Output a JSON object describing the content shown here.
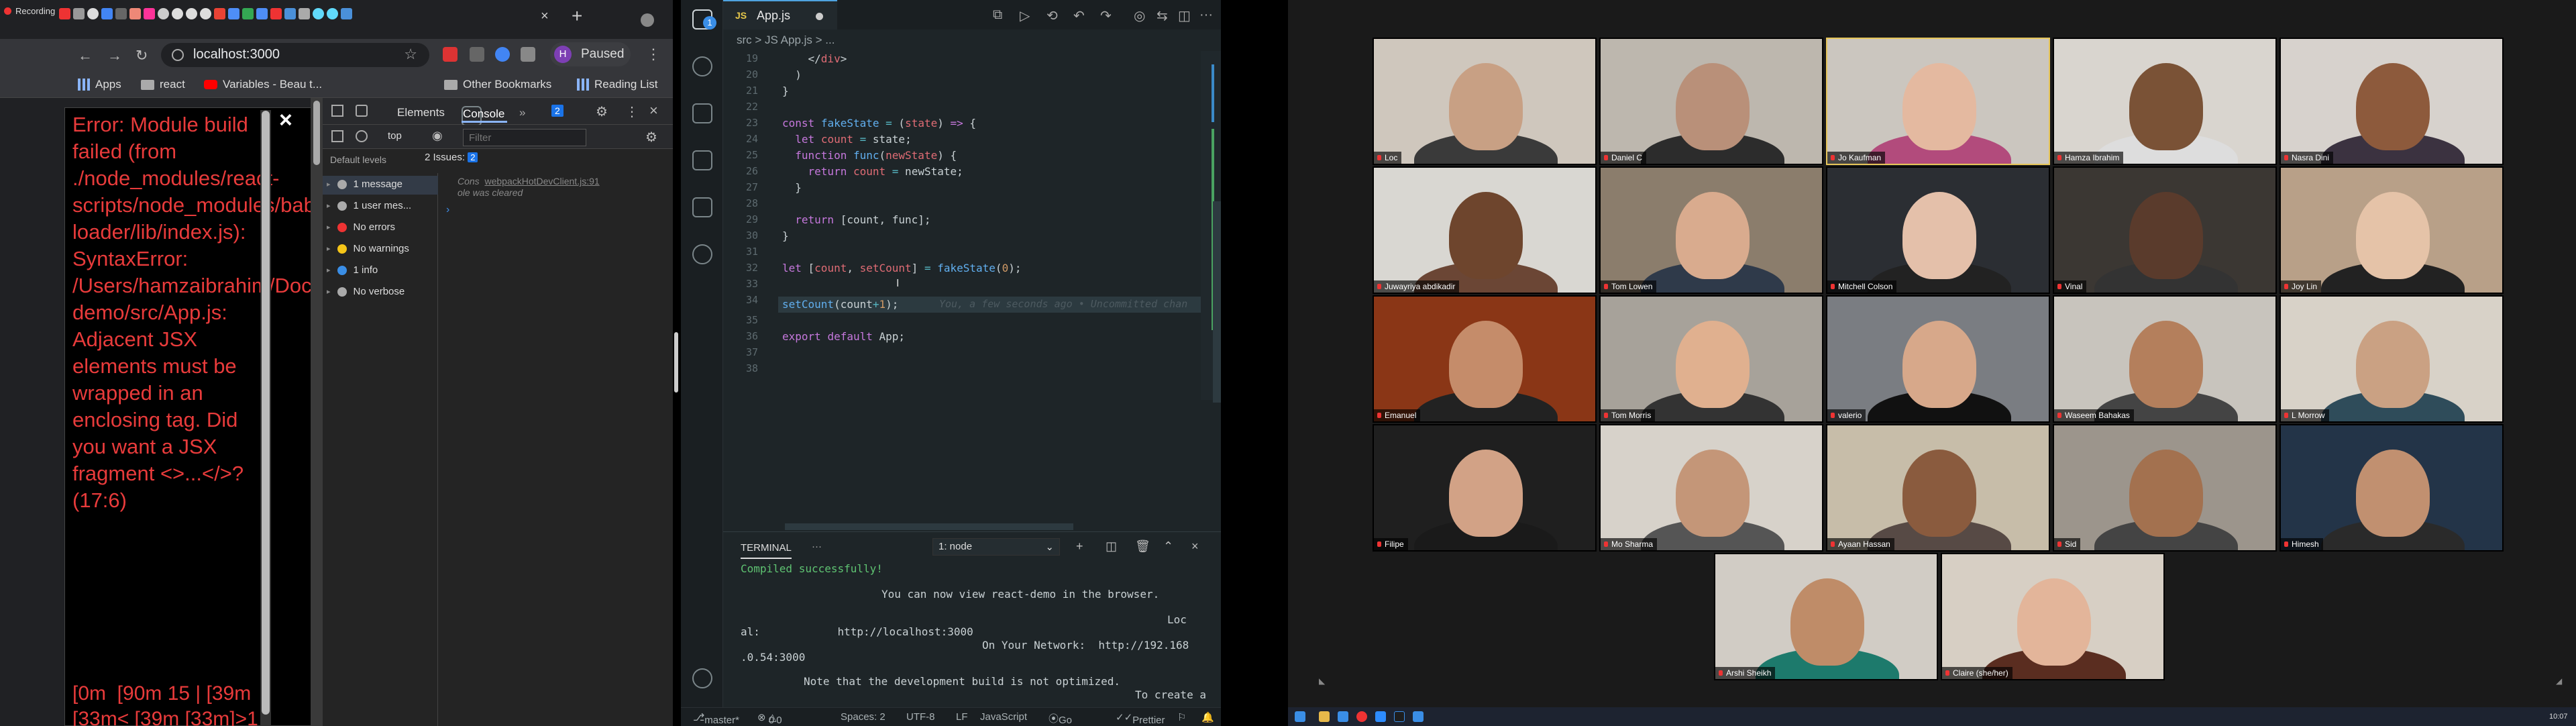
{
  "recording": {
    "label": "Recording"
  },
  "browser": {
    "tabs": [
      {
        "icon": "youtube",
        "color": "#e33"
      },
      {
        "icon": "gear",
        "color": "#999"
      },
      {
        "icon": "github",
        "color": "#ddd"
      },
      {
        "icon": "google",
        "color": "#4285f4"
      },
      {
        "icon": "codepen",
        "color": "#666"
      },
      {
        "icon": "box",
        "color": "#e87"
      },
      {
        "icon": "box",
        "color": "#f39"
      },
      {
        "icon": "circle",
        "color": "#ccc"
      },
      {
        "icon": "github",
        "color": "#ddd"
      },
      {
        "icon": "github",
        "color": "#ddd"
      },
      {
        "icon": "github",
        "color": "#ddd"
      },
      {
        "icon": "google",
        "color": "#ea4335"
      },
      {
        "icon": "doc",
        "color": "#4e8ef7"
      },
      {
        "icon": "doc",
        "color": "#34a853"
      },
      {
        "icon": "box",
        "color": "#4e8ef7"
      },
      {
        "icon": "box",
        "color": "#e33"
      },
      {
        "icon": "box",
        "color": "#4a90d9"
      },
      {
        "icon": "box",
        "color": "#aaa"
      },
      {
        "icon": "react",
        "color": "#61dafb"
      },
      {
        "icon": "react",
        "color": "#61dafb"
      },
      {
        "icon": "doc",
        "color": "#4a90d9"
      }
    ],
    "url": "localhost:3000",
    "profile_initial": "H",
    "profile_state": "Paused",
    "bookmarks": {
      "apps": "Apps",
      "react": "react",
      "variables": "Variables - Beau t...",
      "other": "Other Bookmarks",
      "reading": "Reading List"
    }
  },
  "error_overlay": {
    "message": "Error: Module build failed (from ./node_modules/react-scripts/node_modules/babel-loader/lib/index.js): SyntaxError: /Users/hamzaibrahim/Documents/react-demo/src/App.js: Adjacent JSX elements must be wrapped in an enclosing tag. Did you want a JSX fragment <>...</>? (17:6)",
    "code_fragment": "[0m  [90m 15 | [39m\n[33m< [39m [33m]>1"
  },
  "devtools": {
    "tabs": [
      "Elements",
      "Console"
    ],
    "more": "»",
    "badge": "2",
    "context": "top",
    "filter_placeholder": "Filter",
    "default_levels": "Default levels",
    "issues_label": "2 Issues:",
    "issues_count": "2",
    "sidebar": [
      {
        "label": "1 message",
        "icon": "list",
        "color": "#aaa"
      },
      {
        "label": "1 user mes...",
        "icon": "user",
        "color": "#aaa"
      },
      {
        "label": "No errors",
        "icon": "error",
        "color": "#e33"
      },
      {
        "label": "No warnings",
        "icon": "warning",
        "color": "#f5c518"
      },
      {
        "label": "1 info",
        "icon": "info",
        "color": "#3a8ee6"
      },
      {
        "label": "No verbose",
        "icon": "bug",
        "color": "#aaa"
      }
    ],
    "console_source": "webpackHotDevClient.js:91",
    "console_prefix": "Cons",
    "console_message": "ole was cleared",
    "prompt": "›"
  },
  "vscode": {
    "tab_name": "App.js",
    "tab_lang": "JS",
    "breadcrumb": "src  >  JS App.js  >  ...",
    "explorer_badge": "1",
    "line_numbers": [
      "19",
      "20",
      "21",
      "22",
      "23",
      "24",
      "25",
      "26",
      "27",
      "28",
      "29",
      "30",
      "31",
      "32",
      "33",
      "34",
      "35",
      "36",
      "37",
      "38"
    ],
    "blame": "You, a few seconds ago • Uncommitted chan",
    "terminal": {
      "tab": "TERMINAL",
      "more": "···",
      "selector": "1: node",
      "lines": [
        "Compiled successfully!",
        "You can now view react-demo in the browser.",
        "Loc",
        "al:            http://localhost:3000",
        "On Your Network:  http://192.168",
        ".0.54:3000",
        "Note that the development build is not optimized.",
        "To create a"
      ]
    },
    "status": {
      "branch": "master*",
      "problems": "0",
      "warnings": "0",
      "spaces": "Spaces: 2",
      "encoding": "UTF-8",
      "eol": "LF",
      "language": "JavaScript",
      "golive": "Go Live",
      "prettier": "Prettier"
    }
  },
  "zoom": {
    "participants": [
      {
        "name": "Loc",
        "skin": "#c8a084",
        "shirt": "#3a3a3a",
        "bg": "#cfc7bd"
      },
      {
        "name": "Daniel C",
        "skin": "#b99079",
        "shirt": "#2c2c2c",
        "bg": "#bdb7ae"
      },
      {
        "name": "Jo Kaufman",
        "skin": "#e4b9a0",
        "shirt": "#b24b7c",
        "bg": "#cbc6bf",
        "active": true
      },
      {
        "name": "Hamza Ibrahim",
        "skin": "#7a5236",
        "shirt": "#ddd",
        "bg": "#d9d5cf"
      },
      {
        "name": "Nasra Dini",
        "skin": "#8d5a3c",
        "shirt": "#3b3240",
        "bg": "#d7d2cd"
      },
      {
        "name": "Juwayriya abdikadir",
        "skin": "#6e452d",
        "shirt": "#6b4635",
        "bg": "#d9d7d2"
      },
      {
        "name": "Tom Lowen",
        "skin": "#d9ab8e",
        "shirt": "#2f3a4a",
        "bg": "#8b7d6c"
      },
      {
        "name": "Mitchell Colson",
        "skin": "#e4c0aa",
        "shirt": "#222",
        "bg": "#2b2e33"
      },
      {
        "name": "Vinal",
        "skin": "#5a3b2c",
        "shirt": "#333",
        "bg": "#3b3733"
      },
      {
        "name": "Joy Lin",
        "skin": "#e5c3a8",
        "shirt": "#222",
        "bg": "#b8a088"
      },
      {
        "name": "Emanuel",
        "skin": "#c58c6a",
        "shirt": "#222",
        "bg": "#8a3616"
      },
      {
        "name": "Tom Morris",
        "skin": "#e0b08f",
        "shirt": "#333",
        "bg": "#a7a29a"
      },
      {
        "name": "valerio",
        "skin": "#d7a88a",
        "shirt": "#111",
        "bg": "#7a7d82"
      },
      {
        "name": "Waseem Bahakas",
        "skin": "#b47f5c",
        "shirt": "#444",
        "bg": "#c8c4bd"
      },
      {
        "name": "L Morrow",
        "skin": "#caa183",
        "shirt": "#2f4c5a",
        "bg": "#d8d2c8"
      },
      {
        "name": "Filipe",
        "skin": "#d2a286",
        "shirt": "#1a1a1a",
        "bg": "#1f1f1f"
      },
      {
        "name": "Mo Sharma",
        "skin": "#c49678",
        "shirt": "#555",
        "bg": "#d7d2ca"
      },
      {
        "name": "Ayaan Hassan",
        "skin": "#8a5b3e",
        "shirt": "#574a45",
        "bg": "#c7bda9"
      },
      {
        "name": "Sid",
        "skin": "#a3714f",
        "shirt": "#444",
        "bg": "#9c958c"
      },
      {
        "name": "Himesh",
        "skin": "#c19070",
        "shirt": "#2a2a2a",
        "bg": "#233448"
      },
      {
        "name": "Arshi Sheikh",
        "skin": "#bf8c68",
        "shirt": "#1d7a6c",
        "bg": "#d1ccc5"
      },
      {
        "name": "Claire (she/her)",
        "skin": "#e3b59a",
        "shirt": "#5a2d20",
        "bg": "#d7cfc4"
      }
    ]
  },
  "taskbar": {
    "clock": "10:07"
  }
}
